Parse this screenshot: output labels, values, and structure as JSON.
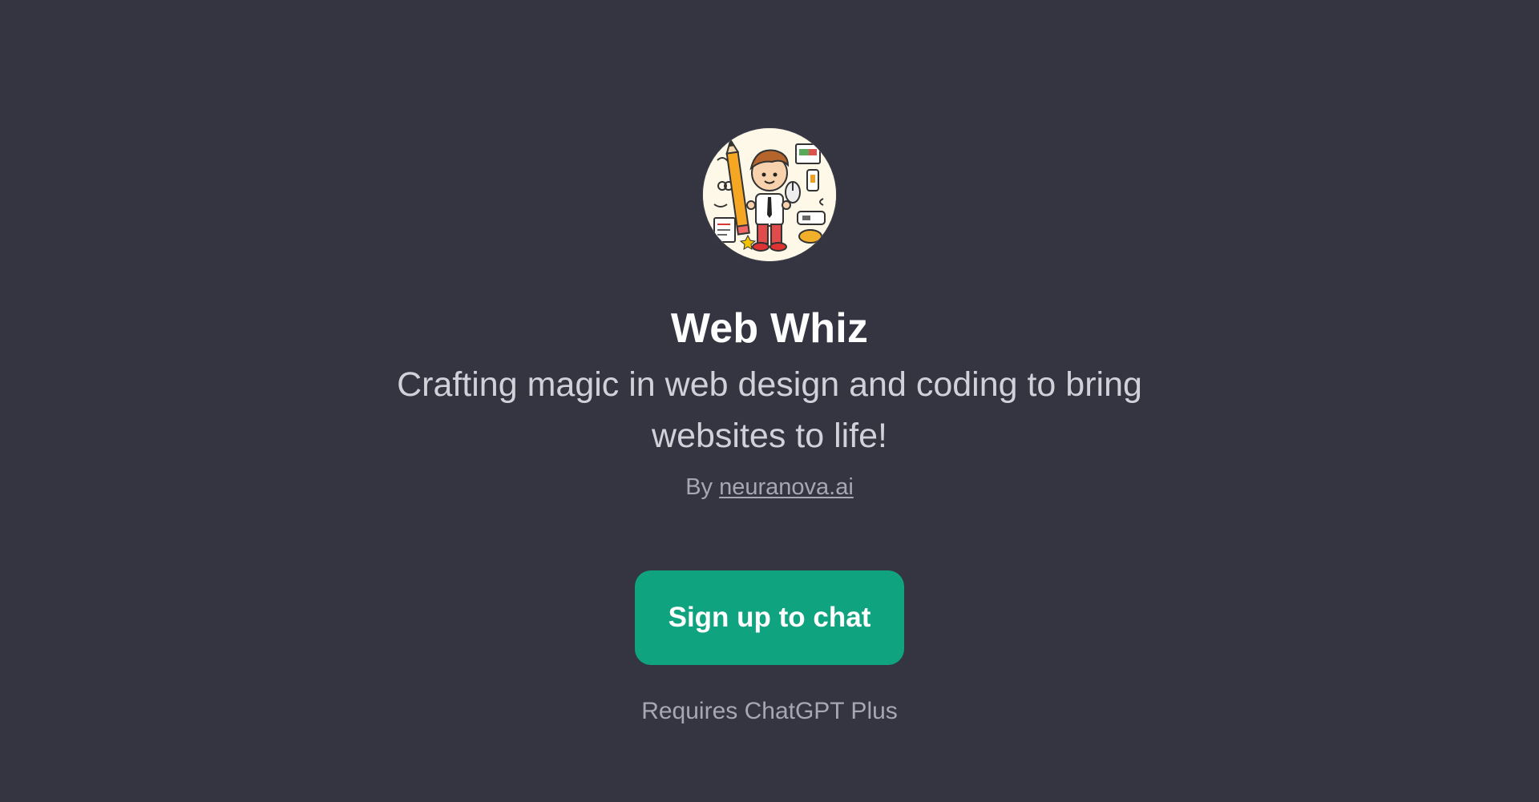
{
  "gpt": {
    "name": "Web Whiz",
    "description": "Crafting magic in web design and coding to bring websites to life!",
    "by_prefix": "By",
    "author": "neuranova.ai",
    "avatar_icon": "cartoon-web-designer-avatar"
  },
  "cta": {
    "label": "Sign up to chat"
  },
  "note": "Requires ChatGPT Plus",
  "colors": {
    "background": "#343541",
    "button": "#10a37f",
    "title": "#ffffff",
    "subtitle": "#d1d1da",
    "muted": "#a7a7b3"
  }
}
